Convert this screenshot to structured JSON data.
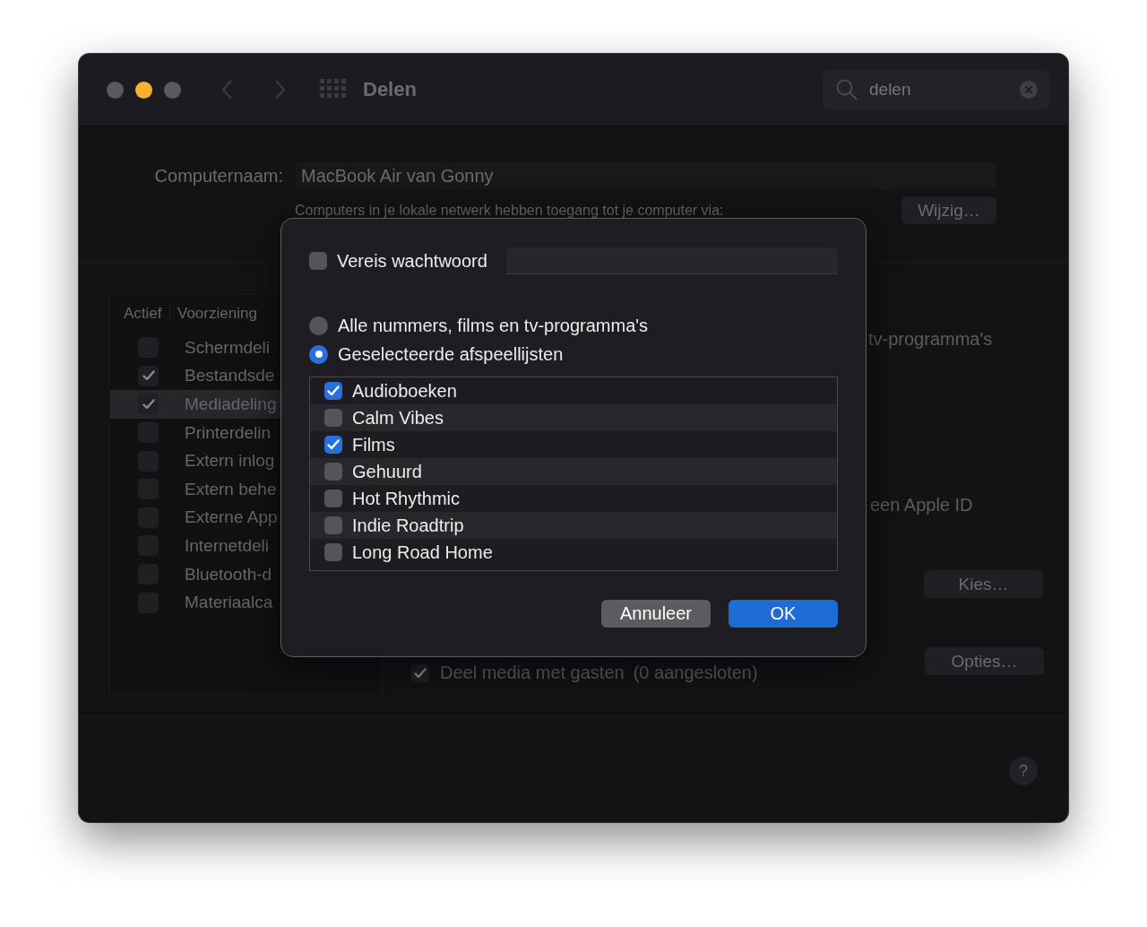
{
  "window": {
    "title": "Delen",
    "traffic_lights": [
      {
        "color": "#5a595e"
      },
      {
        "color": "#f6b22f"
      },
      {
        "color": "#5a595e"
      }
    ]
  },
  "search": {
    "value": "delen"
  },
  "computer_name": {
    "label": "Computernaam:",
    "value": "MacBook Air van Gonny",
    "note": "Computers in je lokale netwerk hebben toegang tot je computer via:",
    "button": "Wijzig…"
  },
  "services": {
    "columns": [
      "Actief",
      "Voorziening"
    ],
    "rows": [
      {
        "name": "Schermdeli",
        "checked": false,
        "selected": false
      },
      {
        "name": "Bestandsde",
        "checked": true,
        "selected": false
      },
      {
        "name": "Mediadeling",
        "checked": true,
        "selected": true
      },
      {
        "name": "Printerdelin",
        "checked": false,
        "selected": false
      },
      {
        "name": "Extern inlog",
        "checked": false,
        "selected": false
      },
      {
        "name": "Extern behe",
        "checked": false,
        "selected": false
      },
      {
        "name": "Externe App",
        "checked": false,
        "selected": false
      },
      {
        "name": "Internetdeli",
        "checked": false,
        "selected": false
      },
      {
        "name": "Bluetooth-d",
        "checked": false,
        "selected": false
      },
      {
        "name": "Materiaalca",
        "checked": false,
        "selected": false
      }
    ]
  },
  "detail": {
    "library_text": "tv-programma's",
    "apple_id_text": "een Apple ID",
    "choose_button": "Kies…",
    "guests": {
      "label": "Deel media met gasten",
      "count": "(0 aangesloten)",
      "checked": true
    },
    "options_button": "Opties…"
  },
  "help": "?",
  "sheet": {
    "password": {
      "label": "Vereis wachtwoord",
      "checked": false
    },
    "options": [
      {
        "label": "Alle nummers, films en tv-programma's",
        "selected": false
      },
      {
        "label": "Geselecteerde afspeellijsten",
        "selected": true
      }
    ],
    "playlists": [
      {
        "name": "Audioboeken",
        "checked": true
      },
      {
        "name": "Calm Vibes",
        "checked": false
      },
      {
        "name": "Films",
        "checked": true
      },
      {
        "name": "Gehuurd",
        "checked": false
      },
      {
        "name": "Hot Rhythmic",
        "checked": false
      },
      {
        "name": "Indie Roadtrip",
        "checked": false
      },
      {
        "name": "Long Road Home",
        "checked": false
      }
    ],
    "buttons": [
      {
        "label": "Annuleer",
        "kind": "cancel"
      },
      {
        "label": "OK",
        "kind": "default"
      }
    ]
  }
}
